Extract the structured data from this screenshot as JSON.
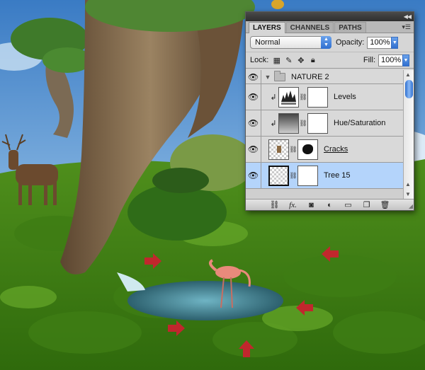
{
  "panel": {
    "tabs": [
      {
        "label": "LAYERS"
      },
      {
        "label": "CHANNELS"
      },
      {
        "label": "PATHS"
      }
    ],
    "blend_mode": "Normal",
    "opacity_label": "Opacity:",
    "opacity_value": "100%",
    "lock_label": "Lock:",
    "fill_label": "Fill:",
    "fill_value": "100%",
    "layers": [
      {
        "name": "NATURE 2"
      },
      {
        "name": "Levels"
      },
      {
        "name": "Hue/Saturation"
      },
      {
        "name": "Cracks"
      },
      {
        "name": "Tree 15"
      }
    ],
    "footer_icons": [
      "link-icon",
      "fx-icon",
      "mask-icon",
      "adjustment-icon",
      "folder-icon",
      "new-layer-icon",
      "trash-icon"
    ]
  },
  "colors": {
    "selection": "#b4d4fb",
    "scroll_accent": "#2e6fd0",
    "arrow_red": "#c1272d"
  }
}
